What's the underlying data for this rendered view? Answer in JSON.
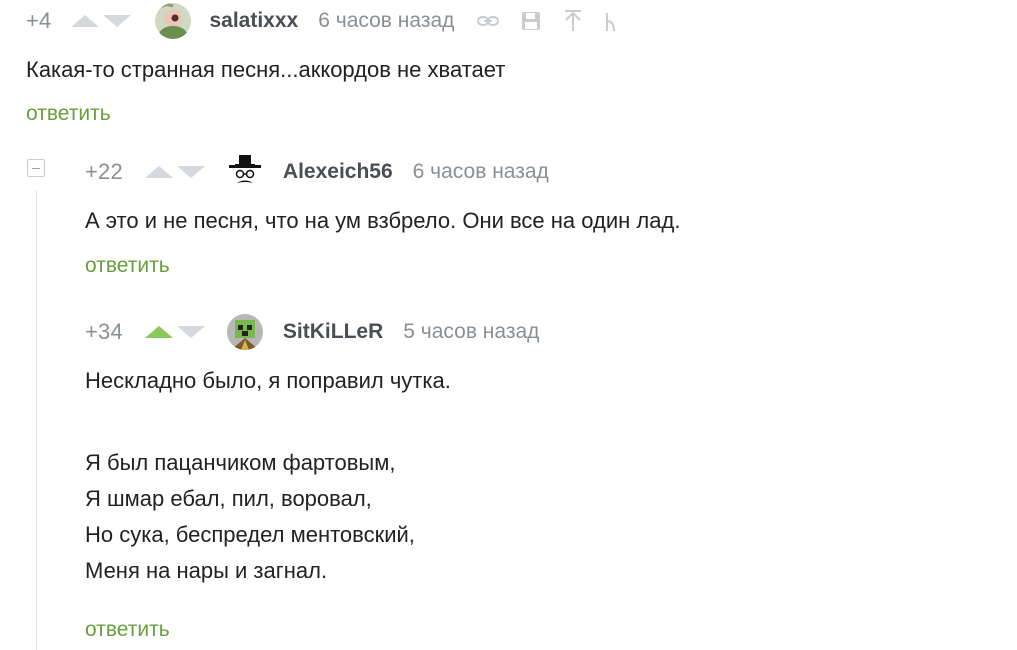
{
  "comments": [
    {
      "rating": "+4",
      "username": "salatixxx",
      "time": "6 часов назад",
      "upvoted": false,
      "lines": [
        "Какая-то странная песня...аккордов не хватает"
      ],
      "reply_label": "ответить"
    },
    {
      "rating": "+22",
      "username": "Alexeich56",
      "time": "6 часов назад",
      "upvoted": false,
      "lines": [
        "А это и не песня, что на ум взбрело. Они все на один лад."
      ],
      "reply_label": "ответить"
    },
    {
      "rating": "+34",
      "username": "SitKiLLeR",
      "time": "5 часов назад",
      "upvoted": true,
      "lines": [
        "Нескладно было, я поправил чутка.",
        "",
        "Я был пацанчиком фартовым,",
        "Я шмар ебал, пил, воровал,",
        "Но сука, беспредел ментовский,",
        "Меня на нары и загнал."
      ],
      "reply_label": "ответить"
    }
  ],
  "icons": {
    "tools": [
      "link-icon",
      "save-icon",
      "upload-icon",
      "branch-icon"
    ]
  },
  "colors": {
    "reply_link": "#6a9f3e",
    "upvote_active": "#8ac858",
    "vote_inactive": "#d5d8dc",
    "meta_gray": "#8a8f96"
  }
}
